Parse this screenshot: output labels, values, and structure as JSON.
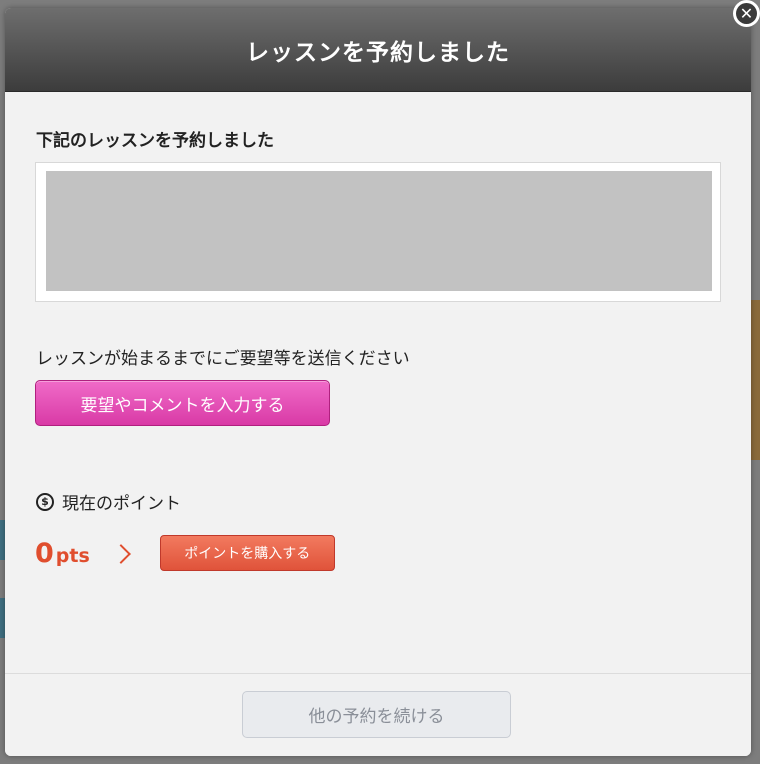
{
  "modal": {
    "title": "レッスンを予約しました",
    "section_title": "下記のレッスンを予約しました",
    "request_text": "レッスンが始まるまでにご要望等を送信ください",
    "request_button_label": "要望やコメントを入力する",
    "points_label": "現在のポイント",
    "points_value": "0",
    "points_unit": "pts",
    "buy_button_label": "ポイントを購入する",
    "continue_button_label": "他の予約を続ける",
    "close_symbol": "✕",
    "coin_symbol": "$"
  },
  "icons": {
    "close": "close-icon",
    "coin": "coin-icon",
    "chevron": "chevron-right-icon"
  },
  "colors": {
    "header_dark": "#3c3c3c",
    "request_button": "#e04fb3",
    "points_accent": "#e04e2e",
    "buy_button": "#e8664a",
    "continue_button_bg": "#e9ebee",
    "lesson_placeholder": "#c2c2c2"
  }
}
